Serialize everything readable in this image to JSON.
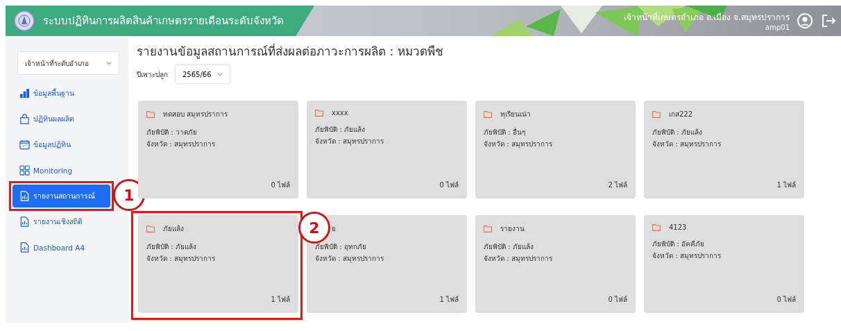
{
  "header": {
    "title": "ระบบปฏิทินการผลิตสินค้าเกษตรรายเดือนระดับจังหวัด",
    "user_name": "เจ้าหน้าที่เกษตรอำเภอ อ.เมือง จ.สมุทรปราการ",
    "user_id": "amp01"
  },
  "sidebar": {
    "role_select": "เจ้าหน้าที่ระดับอำเภอ",
    "items": [
      {
        "label": "ข้อมูลพื้นฐาน",
        "kind": "bars",
        "selected": false
      },
      {
        "label": "ปฏิทินผลผลิต",
        "kind": "bag",
        "selected": false
      },
      {
        "label": "ข้อมูลปฏิทิน",
        "kind": "calendar",
        "selected": false
      },
      {
        "label": "Monitoring",
        "kind": "grid",
        "selected": false
      },
      {
        "label": "รายงานสถานการณ์",
        "kind": "report",
        "selected": true,
        "callout": "1"
      },
      {
        "label": "รายงานเชิงสถิติ",
        "kind": "report",
        "selected": false
      },
      {
        "label": "Dashboard A4",
        "kind": "report",
        "selected": false
      }
    ]
  },
  "page": {
    "title": "รายงานข้อมูลสถานการณ์ที่ส่งผลต่อภาวะการผลิต : หมวดพืช",
    "season_label": "ปีเพาะปลูก",
    "season_value": "2565/66"
  },
  "cards": [
    {
      "title": "ทดสอบ สมุทรปราการ",
      "hazard": "ภัยพิบัติ : วาตภัย",
      "province": "จังหวัด : สมุทรปราการ",
      "files": "0 ไฟล์"
    },
    {
      "title": "xxxx",
      "hazard": "ภัยพิบัติ : ภัยแล้ง",
      "province": "จังหวัด : สมุทรปราการ",
      "files": "0 ไฟล์"
    },
    {
      "title": "ทุเรียนเน่า",
      "hazard": "ภัยพิบัติ : อื่นๆ",
      "province": "จังหวัด : สมุทรปราการ",
      "files": "2 ไฟล์"
    },
    {
      "title": "เกส222",
      "hazard": "ภัยพิบัติ : ภัยแล้ง",
      "province": "จังหวัด : สมุทรปราการ",
      "files": "1 ไฟล์"
    },
    {
      "title": "ภัยแล้ง",
      "hazard": "ภัยพิบัติ : ภัยแล้ง",
      "province": "จังหวัด : สมุทรปราการ",
      "files": "1 ไฟล์",
      "callout": "2"
    },
    {
      "title": "ย",
      "hazard": "ภัยพิบัติ : อุทกภัย",
      "province": "จังหวัด : สมุทรปราการ",
      "files": "1 ไฟล์"
    },
    {
      "title": "รายงาน",
      "hazard": "ภัยพิบัติ : ภัยแล้ง",
      "province": "จังหวัด : สมุทรปราการ",
      "files": "0 ไฟล์"
    },
    {
      "title": "4123",
      "hazard": "ภัยพิบัติ : อัคคีภัย",
      "province": "จังหวัด : สมุทรปราการ",
      "files": "0 ไฟล์"
    }
  ]
}
